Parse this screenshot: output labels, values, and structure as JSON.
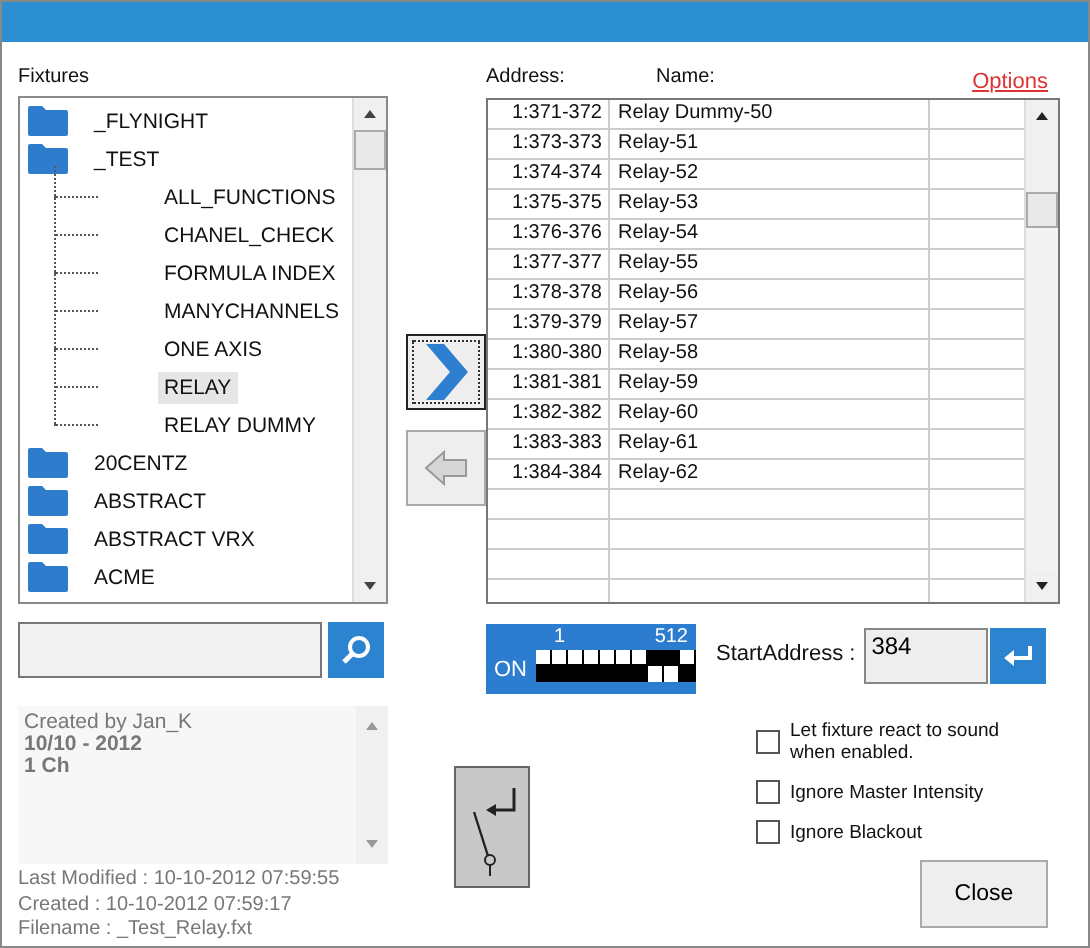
{
  "fixtures": {
    "label": "Fixtures",
    "tree": [
      {
        "label": "_FLYNIGHT",
        "kind": "folder",
        "selected": false
      },
      {
        "label": "_TEST",
        "kind": "folder",
        "selected": false,
        "children": [
          {
            "label": "ALL_FUNCTIONS",
            "kind": "fixture",
            "selected": false
          },
          {
            "label": "CHANEL_CHECK",
            "kind": "fixture",
            "selected": false
          },
          {
            "label": "FORMULA INDEX",
            "kind": "fixture",
            "selected": false
          },
          {
            "label": "MANYCHANNELS",
            "kind": "fixture",
            "selected": false
          },
          {
            "label": "ONE AXIS",
            "kind": "fixture",
            "selected": false
          },
          {
            "label": "RELAY",
            "kind": "fixture",
            "selected": true
          },
          {
            "label": "RELAY DUMMY",
            "kind": "fixture",
            "selected": false
          }
        ]
      },
      {
        "label": "20CENTZ",
        "kind": "folder",
        "selected": false
      },
      {
        "label": "ABSTRACT",
        "kind": "folder",
        "selected": false
      },
      {
        "label": "ABSTRACT VRX",
        "kind": "folder",
        "selected": false
      },
      {
        "label": "ACME",
        "kind": "folder",
        "selected": false
      }
    ]
  },
  "info": {
    "lines": [
      {
        "text": "Created by Jan_K",
        "bold": false
      },
      {
        "text": "10/10 - 2012",
        "bold": true
      },
      {
        "text": "1 Ch",
        "bold": true
      }
    ]
  },
  "file_info": [
    "Last Modified : 10-10-2012 07:59:55",
    "Created : 10-10-2012 07:59:17",
    "Filename : _Test_Relay.fxt"
  ],
  "patch": {
    "columns": [
      "Address:",
      "Name:"
    ],
    "options_link": "Options",
    "rows": [
      {
        "address": "1:371-372",
        "name": "Relay Dummy-50"
      },
      {
        "address": "1:373-373",
        "name": "Relay-51"
      },
      {
        "address": "1:374-374",
        "name": "Relay-52"
      },
      {
        "address": "1:375-375",
        "name": "Relay-53"
      },
      {
        "address": "1:376-376",
        "name": "Relay-54"
      },
      {
        "address": "1:377-377",
        "name": "Relay-55"
      },
      {
        "address": "1:378-378",
        "name": "Relay-56"
      },
      {
        "address": "1:379-379",
        "name": "Relay-57"
      },
      {
        "address": "1:380-380",
        "name": "Relay-58"
      },
      {
        "address": "1:381-381",
        "name": "Relay-59"
      },
      {
        "address": "1:382-382",
        "name": "Relay-60"
      },
      {
        "address": "1:383-383",
        "name": "Relay-61"
      },
      {
        "address": "1:384-384",
        "name": "Relay-62"
      }
    ]
  },
  "dip_switch": {
    "first": "1",
    "last": "512",
    "on_label": "ON",
    "switches": [
      {
        "on": false
      },
      {
        "on": false
      },
      {
        "on": false
      },
      {
        "on": false
      },
      {
        "on": false
      },
      {
        "on": false
      },
      {
        "on": false
      },
      {
        "on": true
      },
      {
        "on": true
      },
      {
        "on": false
      }
    ]
  },
  "start_address": {
    "label": "StartAddress :",
    "value": "384"
  },
  "options": [
    {
      "label": "Let fixture react to sound when enabled.",
      "checked": false
    },
    {
      "label": "Ignore Master Intensity",
      "checked": false
    },
    {
      "label": "Ignore Blackout",
      "checked": false
    }
  ],
  "close_button": "Close"
}
